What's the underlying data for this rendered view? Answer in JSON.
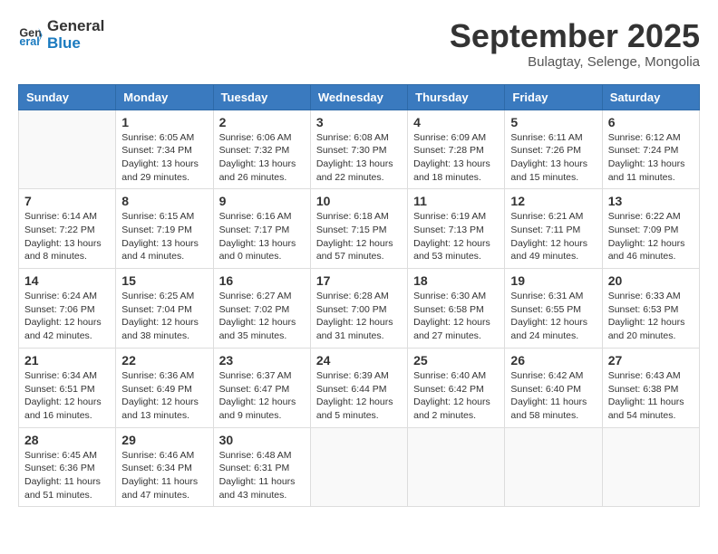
{
  "logo": {
    "line1": "General",
    "line2": "Blue"
  },
  "title": "September 2025",
  "subtitle": "Bulagtay, Selenge, Mongolia",
  "days_of_week": [
    "Sunday",
    "Monday",
    "Tuesday",
    "Wednesday",
    "Thursday",
    "Friday",
    "Saturday"
  ],
  "weeks": [
    [
      {
        "day": "",
        "info": ""
      },
      {
        "day": "1",
        "info": "Sunrise: 6:05 AM\nSunset: 7:34 PM\nDaylight: 13 hours\nand 29 minutes."
      },
      {
        "day": "2",
        "info": "Sunrise: 6:06 AM\nSunset: 7:32 PM\nDaylight: 13 hours\nand 26 minutes."
      },
      {
        "day": "3",
        "info": "Sunrise: 6:08 AM\nSunset: 7:30 PM\nDaylight: 13 hours\nand 22 minutes."
      },
      {
        "day": "4",
        "info": "Sunrise: 6:09 AM\nSunset: 7:28 PM\nDaylight: 13 hours\nand 18 minutes."
      },
      {
        "day": "5",
        "info": "Sunrise: 6:11 AM\nSunset: 7:26 PM\nDaylight: 13 hours\nand 15 minutes."
      },
      {
        "day": "6",
        "info": "Sunrise: 6:12 AM\nSunset: 7:24 PM\nDaylight: 13 hours\nand 11 minutes."
      }
    ],
    [
      {
        "day": "7",
        "info": "Sunrise: 6:14 AM\nSunset: 7:22 PM\nDaylight: 13 hours\nand 8 minutes."
      },
      {
        "day": "8",
        "info": "Sunrise: 6:15 AM\nSunset: 7:19 PM\nDaylight: 13 hours\nand 4 minutes."
      },
      {
        "day": "9",
        "info": "Sunrise: 6:16 AM\nSunset: 7:17 PM\nDaylight: 13 hours\nand 0 minutes."
      },
      {
        "day": "10",
        "info": "Sunrise: 6:18 AM\nSunset: 7:15 PM\nDaylight: 12 hours\nand 57 minutes."
      },
      {
        "day": "11",
        "info": "Sunrise: 6:19 AM\nSunset: 7:13 PM\nDaylight: 12 hours\nand 53 minutes."
      },
      {
        "day": "12",
        "info": "Sunrise: 6:21 AM\nSunset: 7:11 PM\nDaylight: 12 hours\nand 49 minutes."
      },
      {
        "day": "13",
        "info": "Sunrise: 6:22 AM\nSunset: 7:09 PM\nDaylight: 12 hours\nand 46 minutes."
      }
    ],
    [
      {
        "day": "14",
        "info": "Sunrise: 6:24 AM\nSunset: 7:06 PM\nDaylight: 12 hours\nand 42 minutes."
      },
      {
        "day": "15",
        "info": "Sunrise: 6:25 AM\nSunset: 7:04 PM\nDaylight: 12 hours\nand 38 minutes."
      },
      {
        "day": "16",
        "info": "Sunrise: 6:27 AM\nSunset: 7:02 PM\nDaylight: 12 hours\nand 35 minutes."
      },
      {
        "day": "17",
        "info": "Sunrise: 6:28 AM\nSunset: 7:00 PM\nDaylight: 12 hours\nand 31 minutes."
      },
      {
        "day": "18",
        "info": "Sunrise: 6:30 AM\nSunset: 6:58 PM\nDaylight: 12 hours\nand 27 minutes."
      },
      {
        "day": "19",
        "info": "Sunrise: 6:31 AM\nSunset: 6:55 PM\nDaylight: 12 hours\nand 24 minutes."
      },
      {
        "day": "20",
        "info": "Sunrise: 6:33 AM\nSunset: 6:53 PM\nDaylight: 12 hours\nand 20 minutes."
      }
    ],
    [
      {
        "day": "21",
        "info": "Sunrise: 6:34 AM\nSunset: 6:51 PM\nDaylight: 12 hours\nand 16 minutes."
      },
      {
        "day": "22",
        "info": "Sunrise: 6:36 AM\nSunset: 6:49 PM\nDaylight: 12 hours\nand 13 minutes."
      },
      {
        "day": "23",
        "info": "Sunrise: 6:37 AM\nSunset: 6:47 PM\nDaylight: 12 hours\nand 9 minutes."
      },
      {
        "day": "24",
        "info": "Sunrise: 6:39 AM\nSunset: 6:44 PM\nDaylight: 12 hours\nand 5 minutes."
      },
      {
        "day": "25",
        "info": "Sunrise: 6:40 AM\nSunset: 6:42 PM\nDaylight: 12 hours\nand 2 minutes."
      },
      {
        "day": "26",
        "info": "Sunrise: 6:42 AM\nSunset: 6:40 PM\nDaylight: 11 hours\nand 58 minutes."
      },
      {
        "day": "27",
        "info": "Sunrise: 6:43 AM\nSunset: 6:38 PM\nDaylight: 11 hours\nand 54 minutes."
      }
    ],
    [
      {
        "day": "28",
        "info": "Sunrise: 6:45 AM\nSunset: 6:36 PM\nDaylight: 11 hours\nand 51 minutes."
      },
      {
        "day": "29",
        "info": "Sunrise: 6:46 AM\nSunset: 6:34 PM\nDaylight: 11 hours\nand 47 minutes."
      },
      {
        "day": "30",
        "info": "Sunrise: 6:48 AM\nSunset: 6:31 PM\nDaylight: 11 hours\nand 43 minutes."
      },
      {
        "day": "",
        "info": ""
      },
      {
        "day": "",
        "info": ""
      },
      {
        "day": "",
        "info": ""
      },
      {
        "day": "",
        "info": ""
      }
    ]
  ]
}
